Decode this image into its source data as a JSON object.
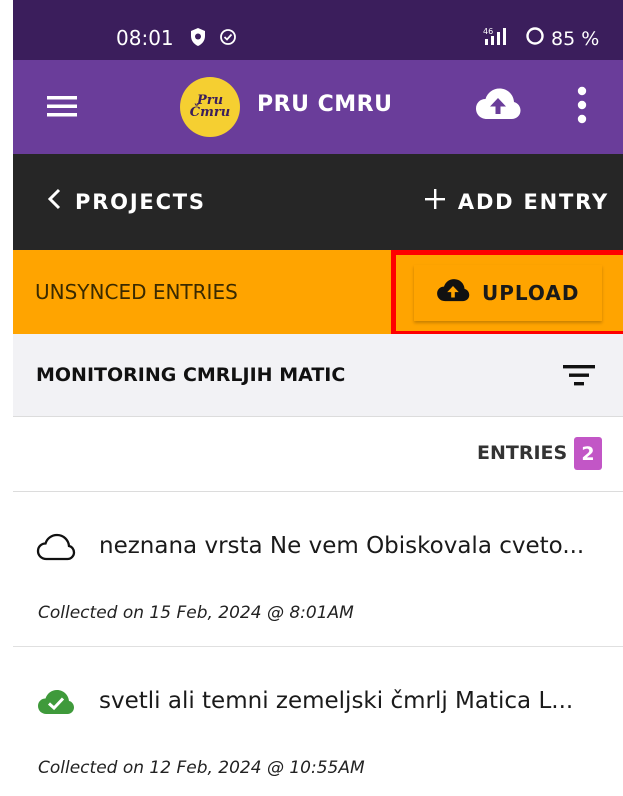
{
  "status_bar": {
    "time": "08:01",
    "network": "46",
    "battery": "85 %",
    "icons": [
      "shield-icon",
      "check-circle-icon",
      "signal-icon",
      "battery-ring-icon"
    ]
  },
  "app_bar": {
    "logo_text_top": "Pru",
    "logo_text_bottom": "Čmru",
    "title": "PRU CMRU",
    "icons": [
      "menu-icon",
      "cloud-upload-icon",
      "more-vert-icon"
    ]
  },
  "nav_bar": {
    "back_label": "PROJECTS",
    "add_label": "ADD ENTRY"
  },
  "unsynced_banner": {
    "label": "UNSYNCED ENTRIES",
    "upload_label": "UPLOAD"
  },
  "project": {
    "title": "MONITORING CMRLJIH MATIC"
  },
  "entries_header": {
    "label": "ENTRIES",
    "count": "2"
  },
  "entries": [
    {
      "title": "neznana vrsta Ne vem Obiskovala cveto...",
      "date": "Collected on 15 Feb, 2024 @ 8:01AM",
      "sync_icon": "cloud-outline-icon"
    },
    {
      "title": "svetli ali temni zemeljski čmrlj Matica L...",
      "date": "Collected on 12 Feb, 2024 @ 10:55AM",
      "sync_icon": "cloud-check-icon"
    }
  ],
  "colors": {
    "status_bar": "#3b1e5c",
    "app_bar": "#6a3d9a",
    "nav_bar": "#262626",
    "banner": "#ffa400",
    "badge": "#c256c6",
    "synced": "#3f9a3b",
    "highlight": "#ff0000"
  }
}
